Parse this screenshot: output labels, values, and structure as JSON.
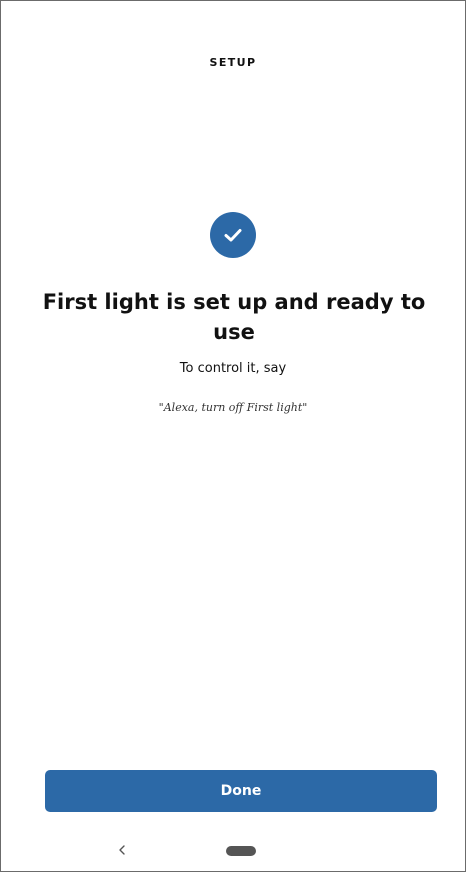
{
  "header": {
    "title": "SETUP"
  },
  "status": {
    "icon": "check-circle-icon",
    "headline": "First light is set up and ready to use",
    "subline": "To control it, say",
    "utterance": "\"Alexa, turn off First light\""
  },
  "actions": {
    "done_label": "Done"
  },
  "nav": {
    "back_icon": "chevron-left-icon",
    "home_icon": "home-pill-icon"
  },
  "colors": {
    "accent": "#2c69a7",
    "text": "#111111",
    "background": "#ffffff"
  }
}
